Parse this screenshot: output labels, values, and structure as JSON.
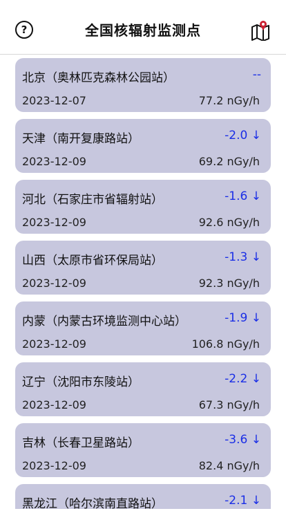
{
  "header": {
    "title": "全国核辐射监测点",
    "help_icon": "?",
    "map_icon": "map-pin-icon"
  },
  "stations": [
    {
      "name": "北京（奥林匹克森林公园站）",
      "change": "--",
      "date": "2023-12-07",
      "value": "77.2 nGy/h"
    },
    {
      "name": "天津（南开复康路站）",
      "change": "-2.0 ↓",
      "date": "2023-12-09",
      "value": "69.2 nGy/h"
    },
    {
      "name": "河北（石家庄市省辐射站）",
      "change": "-1.6 ↓",
      "date": "2023-12-09",
      "value": "92.6 nGy/h"
    },
    {
      "name": "山西（太原市省环保局站）",
      "change": "-1.3 ↓",
      "date": "2023-12-09",
      "value": "92.3 nGy/h"
    },
    {
      "name": "内蒙（内蒙古环境监测中心站）",
      "change": "-1.9 ↓",
      "date": "2023-12-09",
      "value": "106.8 nGy/h"
    },
    {
      "name": "辽宁（沈阳市东陵站）",
      "change": "-2.2 ↓",
      "date": "2023-12-09",
      "value": "67.3 nGy/h"
    },
    {
      "name": "吉林（长春卫星路站）",
      "change": "-3.6 ↓",
      "date": "2023-12-09",
      "value": "82.4 nGy/h"
    },
    {
      "name": "黑龙江（哈尔滨南直路站）",
      "change": "-2.1 ↓",
      "date": "",
      "value": ""
    }
  ],
  "colors": {
    "card_bg": "#c7c7de",
    "change_text": "#1a2ee6",
    "map_pin": "#cc2233"
  }
}
